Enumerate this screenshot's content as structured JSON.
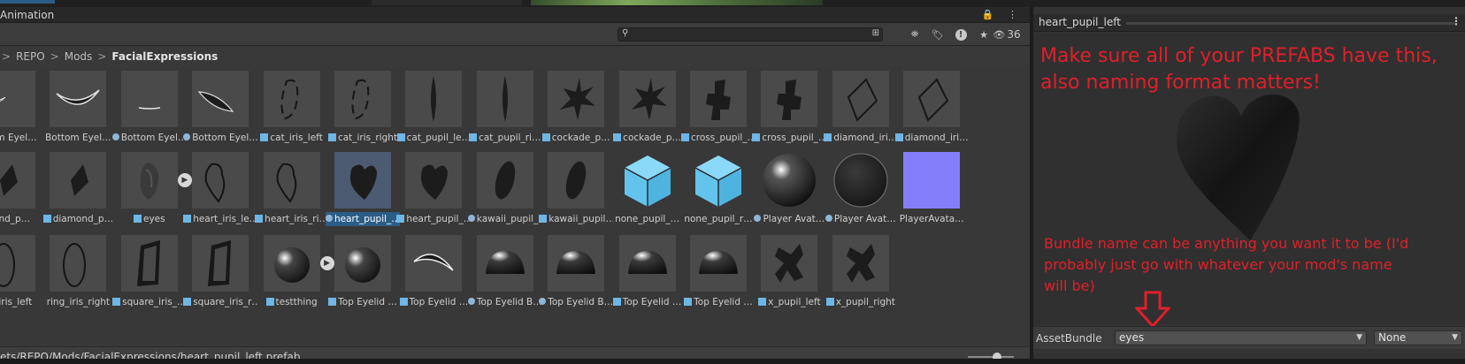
{
  "window_tab": "Animation",
  "toolbar": {
    "hidden_count": "36"
  },
  "breadcrumb": {
    "prefix": ">",
    "items": [
      "REPO",
      "Mods",
      "FacialExpressions"
    ],
    "separator": ">"
  },
  "assets_row1": [
    {
      "label": "ottom Eyel…",
      "kind": "none",
      "shape": "arcdown"
    },
    {
      "label": "Bottom Eyel…",
      "kind": "none",
      "shape": "crescent"
    },
    {
      "label": "Bottom Eyel…",
      "kind": "obj",
      "shape": "thinline"
    },
    {
      "label": "Bottom Eyel…",
      "kind": "obj",
      "shape": "crescent2"
    },
    {
      "label": "cat_iris_left",
      "kind": "prefab",
      "shape": "ringslit"
    },
    {
      "label": "cat_iris_right",
      "kind": "prefab",
      "shape": "ringslit"
    },
    {
      "label": "cat_pupil_le…",
      "kind": "prefab",
      "shape": "slit"
    },
    {
      "label": "cat_pupil_ri…",
      "kind": "prefab",
      "shape": "slit"
    },
    {
      "label": "cockade_p…",
      "kind": "prefab",
      "shape": "star"
    },
    {
      "label": "cockade_p…",
      "kind": "prefab",
      "shape": "star"
    },
    {
      "label": "cross_pupil_…",
      "kind": "prefab",
      "shape": "cross"
    },
    {
      "label": "cross_pupil_…",
      "kind": "prefab",
      "shape": "cross"
    },
    {
      "label": "diamond_iri…",
      "kind": "prefab",
      "shape": "diamondring"
    },
    {
      "label": "diamond_iri…",
      "kind": "prefab",
      "shape": "diamondring"
    }
  ],
  "assets_row2": [
    {
      "label": "mond_p…",
      "kind": "none",
      "shape": "diamond"
    },
    {
      "label": "diamond_p…",
      "kind": "prefab",
      "shape": "diamond"
    },
    {
      "label": "eyes",
      "kind": "prefab",
      "shape": "blob"
    },
    {
      "label": "heart_iris_le…",
      "kind": "prefab",
      "shape": "heartring"
    },
    {
      "label": "heart_iris_ri…",
      "kind": "prefab",
      "shape": "heartring"
    },
    {
      "label": "heart_pupil_…",
      "kind": "obj",
      "shape": "heart",
      "selected": true
    },
    {
      "label": "heart_pupil_…",
      "kind": "prefab",
      "shape": "heart"
    },
    {
      "label": "kawaii_pupil_…",
      "kind": "obj",
      "shape": "oval"
    },
    {
      "label": "kawaii_pupil…",
      "kind": "prefab",
      "shape": "oval"
    },
    {
      "label": "none_pupil_…",
      "kind": "none",
      "shape": "cube"
    },
    {
      "label": "none_pupil_r…",
      "kind": "none",
      "shape": "cube"
    },
    {
      "label": "Player Avat…",
      "kind": "obj",
      "shape": "sphere"
    },
    {
      "label": "Player Avat…",
      "kind": "obj",
      "shape": "sphere2"
    },
    {
      "label": "PlayerAvata…",
      "kind": "none",
      "shape": "normal"
    }
  ],
  "assets_row3": [
    {
      "label": "ng_iris_left",
      "kind": "none",
      "shape": "ring"
    },
    {
      "label": "ring_iris_right",
      "kind": "none",
      "shape": "ring"
    },
    {
      "label": "square_iris_…",
      "kind": "prefab",
      "shape": "square"
    },
    {
      "label": "square_iris_r…",
      "kind": "prefab",
      "shape": "square"
    },
    {
      "label": "testthing",
      "kind": "prefab",
      "shape": "ball"
    },
    {
      "label": "Top Eyelid …",
      "kind": "prefab",
      "shape": "ball"
    },
    {
      "label": "Top Eyelid …",
      "kind": "prefab",
      "shape": "arcup"
    },
    {
      "label": "Top Eyelid B…",
      "kind": "obj",
      "shape": "dome"
    },
    {
      "label": "Top Eyelid B…",
      "kind": "obj",
      "shape": "dome"
    },
    {
      "label": "Top Eyelid …",
      "kind": "prefab",
      "shape": "dome"
    },
    {
      "label": "Top Eyelid …",
      "kind": "prefab",
      "shape": "dome"
    },
    {
      "label": "x_pupil_left",
      "kind": "prefab",
      "shape": "x"
    },
    {
      "label": "x_pupil_right",
      "kind": "prefab",
      "shape": "x"
    }
  ],
  "status": {
    "path": "ets/REPO/Mods/FacialExpressions/heart_pupil_left.prefab"
  },
  "inspector": {
    "title": "heart_pupil_left",
    "note_top": "Make sure all of your PREFABS have this, also naming format matters!",
    "note_bottom": "Bundle name can be anything you want it to be (I'd probably just go with whatever your mod's name will be)",
    "assetbundle_label": "AssetBundle",
    "assetbundle_value": "eyes",
    "variant_value": "None"
  },
  "colors": {
    "selection": "#2c5d87",
    "annotation": "#e0202a",
    "cube": "#6ecff6"
  }
}
